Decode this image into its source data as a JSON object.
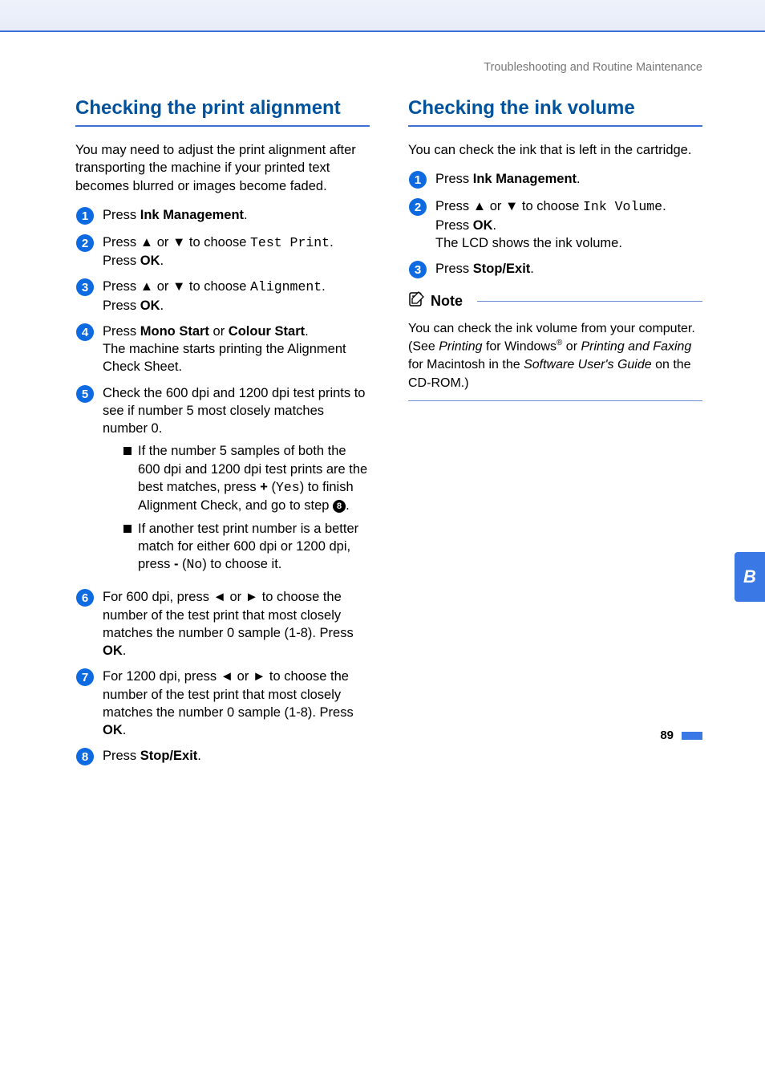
{
  "header": "Troubleshooting and Routine Maintenance",
  "tab": "B",
  "page_number": "89",
  "left": {
    "title": "Checking the print alignment",
    "lead": "You may need to adjust the print alignment after transporting the machine if your printed text becomes blurred or images become faded.",
    "s1_a": "Press ",
    "s1_b": "Ink Management",
    "s1_c": ".",
    "s2_a": "Press ",
    "s2_b": " or ",
    "s2_c": " to choose ",
    "s2_d": "Test Print",
    "s2_e": ".",
    "s2_f": "Press ",
    "s2_g": "OK",
    "s2_h": ".",
    "s3_a": "Press ",
    "s3_b": " or ",
    "s3_c": " to choose ",
    "s3_d": "Alignment",
    "s3_e": ".",
    "s3_f": "Press ",
    "s3_g": "OK",
    "s3_h": ".",
    "s4_a": "Press ",
    "s4_b": "Mono Start",
    "s4_c": " or ",
    "s4_d": "Colour Start",
    "s4_e": ".",
    "s4_f": "The machine starts printing the Alignment Check Sheet.",
    "s5_a": "Check the 600 dpi and 1200 dpi test prints to see if number 5 most closely matches number 0.",
    "s5_b1_a": "If the number 5 samples of both the 600 dpi and 1200 dpi test prints are the best matches, press ",
    "s5_b1_b": "+",
    "s5_b1_c": " (",
    "s5_b1_d": "Yes",
    "s5_b1_e": ") to finish Alignment Check, and go to step ",
    "s5_b1_f": ".",
    "s5_b2_a": "If another test print number is a better match for either 600 dpi or 1200 dpi, press ",
    "s5_b2_b": "-",
    "s5_b2_c": " (",
    "s5_b2_d": "No",
    "s5_b2_e": ") to choose it.",
    "s6_a": "For 600 dpi, press ",
    "s6_b": " or ",
    "s6_c": " to choose the number of the test print that most closely matches the number 0 sample (1-8). Press ",
    "s6_d": "OK",
    "s6_e": ".",
    "s7_a": "For 1200 dpi, press ",
    "s7_b": " or ",
    "s7_c": " to choose the number of the test print that most closely matches the number 0 sample (1-8). Press ",
    "s7_d": "OK",
    "s7_e": ".",
    "s8_a": "Press ",
    "s8_b": "Stop/Exit",
    "s8_c": "."
  },
  "right": {
    "title": "Checking the ink volume",
    "lead": "You can check the ink that is left in the cartridge.",
    "s1_a": "Press ",
    "s1_b": "Ink Management",
    "s1_c": ".",
    "s2_a": "Press ",
    "s2_b": " or ",
    "s2_c": " to choose ",
    "s2_d": "Ink Volume",
    "s2_e": ".",
    "s2_f": "Press ",
    "s2_g": "OK",
    "s2_h": ".",
    "s2_i": "The LCD shows the ink volume.",
    "s3_a": "Press ",
    "s3_b": "Stop/Exit",
    "s3_c": ".",
    "note_label": "Note",
    "note_a": "You can check the ink volume from your computer. (See ",
    "note_b": "Printing",
    "note_c": " for Windows",
    "note_d": " or ",
    "note_e": "Printing and Faxing",
    "note_f": " for Macintosh in the ",
    "note_g": "Software User's Guide",
    "note_h": " on the CD-ROM.)"
  }
}
